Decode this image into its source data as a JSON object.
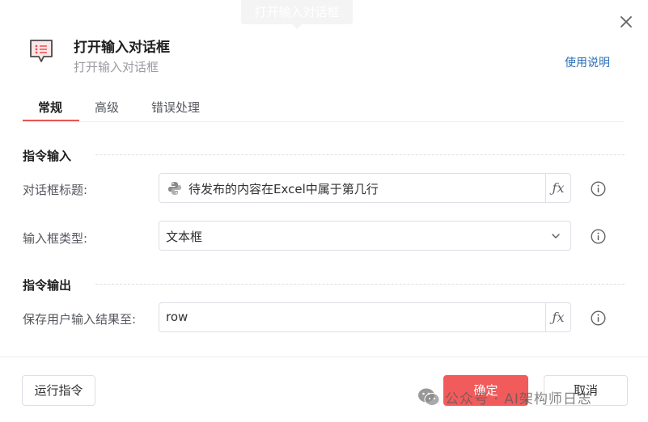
{
  "tooltip": {
    "text": "打开输入对话框"
  },
  "header": {
    "title": "打开输入对话框",
    "subtitle": "打开输入对话框",
    "help_link": "使用说明"
  },
  "tabs": [
    {
      "label": "常规",
      "active": true
    },
    {
      "label": "高级",
      "active": false
    },
    {
      "label": "错误处理",
      "active": false
    }
  ],
  "sections": {
    "input": {
      "title": "指令输入",
      "fields": [
        {
          "label": "对话框标题:",
          "value": "待发布的内容在Excel中属于第几行",
          "icon": "python-icon",
          "fx": "ƒx"
        },
        {
          "label": "输入框类型:",
          "value": "文本框",
          "dropdown": true
        }
      ]
    },
    "output": {
      "title": "指令输出",
      "fields": [
        {
          "label": "保存用户输入结果至:",
          "value": "row",
          "fx": "ƒx"
        }
      ]
    }
  },
  "footer": {
    "run_button": "运行指令",
    "ok_button": "确定",
    "cancel_button": "取消"
  },
  "watermark": {
    "text": "公众号 · AI架构师日志"
  },
  "colors": {
    "accent": "#f25b5b",
    "link": "#2b6fb7",
    "tab_underline": "#e85454"
  }
}
